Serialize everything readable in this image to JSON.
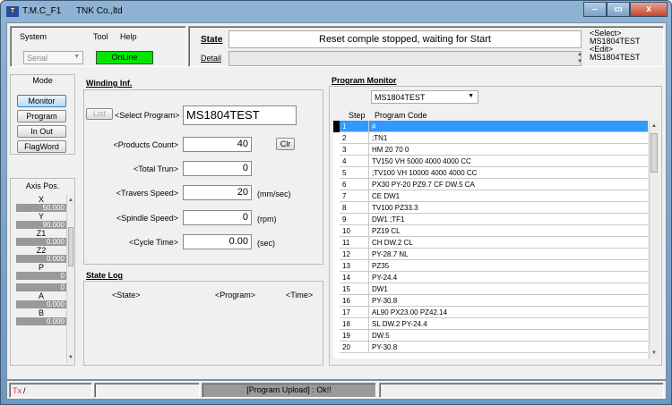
{
  "window": {
    "app_name": "T.M.C_F1",
    "company": "TNK Co.,ltd",
    "icon_text": "T",
    "minimize": "–",
    "maximize": "▭",
    "close": "x"
  },
  "menu": {
    "system": "System",
    "tool": "Tool",
    "help": "Help",
    "port": "Serial",
    "status": "OnLine"
  },
  "state": {
    "label": "State",
    "text": "Reset comple stopped, waiting for Start",
    "detail_label": "Detail",
    "detail_text": ""
  },
  "select_edit": {
    "select_label": "<Select>",
    "select_value": "MS1804TEST",
    "edit_label": "<Edit>",
    "edit_value": "MS1804TEST"
  },
  "mode": {
    "title": "Mode",
    "buttons": [
      "Monitor",
      "Program",
      "In Out",
      "FlagWord"
    ]
  },
  "axis": {
    "title": "Axis Pos.",
    "items": [
      {
        "name": "X",
        "value": "50.000"
      },
      {
        "name": "Y",
        "value": "90.000"
      },
      {
        "name": "Z1",
        "value": "0.000"
      },
      {
        "name": "Z2",
        "value": "0.000"
      },
      {
        "name": "P",
        "value": "0"
      },
      {
        "name": "",
        "value": "0"
      },
      {
        "name": "A",
        "value": "0.000"
      },
      {
        "name": "B",
        "value": "0.000"
      }
    ]
  },
  "winding": {
    "title": "Winding Inf.",
    "list_button": "List",
    "select_program_label": "<Select Program>",
    "select_program_value": "MS1804TEST",
    "products_count_label": "<Products Count>",
    "products_count_value": "40",
    "clr_button": "Clr",
    "total_trun_label": "<Total Trun>",
    "total_trun_value": "0",
    "travers_speed_label": "<Travers Speed>",
    "travers_speed_value": "20",
    "travers_speed_unit": "(mm/sec)",
    "spindle_speed_label": "<Spindle Speed>",
    "spindle_speed_value": "0",
    "spindle_speed_unit": "(rpm)",
    "cycle_time_label": "<Cycle Time>",
    "cycle_time_value": "0.00",
    "cycle_time_unit": "(sec)"
  },
  "state_log": {
    "title": "State Log",
    "col_state": "<State>",
    "col_program": "<Program>",
    "col_time": "<Time>"
  },
  "program_monitor": {
    "title": "Program  Monitor",
    "selected_program": "MS1804TEST",
    "col_step": "Step",
    "col_code": "Program Code",
    "rows": [
      {
        "step": "1",
        "code": "#"
      },
      {
        "step": "2",
        "code": ";TN1"
      },
      {
        "step": "3",
        "code": "HM 20 70 0"
      },
      {
        "step": "4",
        "code": "TV150 VH 5000 4000 4000 CC"
      },
      {
        "step": "5",
        "code": ";TV100 VH 10000 4000 4000 CC"
      },
      {
        "step": "6",
        "code": "PX30 PY-20 PZ9.7 CF DW.5 CA"
      },
      {
        "step": "7",
        "code": "CE DW1"
      },
      {
        "step": "8",
        "code": "TV100 PZ33.3"
      },
      {
        "step": "9",
        "code": "DW1 ;TF1"
      },
      {
        "step": "10",
        "code": "PZ19 CL"
      },
      {
        "step": "11",
        "code": "CH DW.2 CL"
      },
      {
        "step": "12",
        "code": "PY-28.7 NL"
      },
      {
        "step": "13",
        "code": "PZ35"
      },
      {
        "step": "14",
        "code": "PY-24.4"
      },
      {
        "step": "15",
        "code": "DW1"
      },
      {
        "step": "16",
        "code": "PY-30.8"
      },
      {
        "step": "17",
        "code": "AL90 PX23.00 PZ42.14"
      },
      {
        "step": "18",
        "code": "SL DW.2 PY-24.4"
      },
      {
        "step": "19",
        "code": "DW.5"
      },
      {
        "step": "20",
        "code": "PY-30.8"
      }
    ]
  },
  "statusbar": {
    "tx": "Tx",
    "tx_sep": "/",
    "message": "[Program Upload] : Ok!!"
  }
}
